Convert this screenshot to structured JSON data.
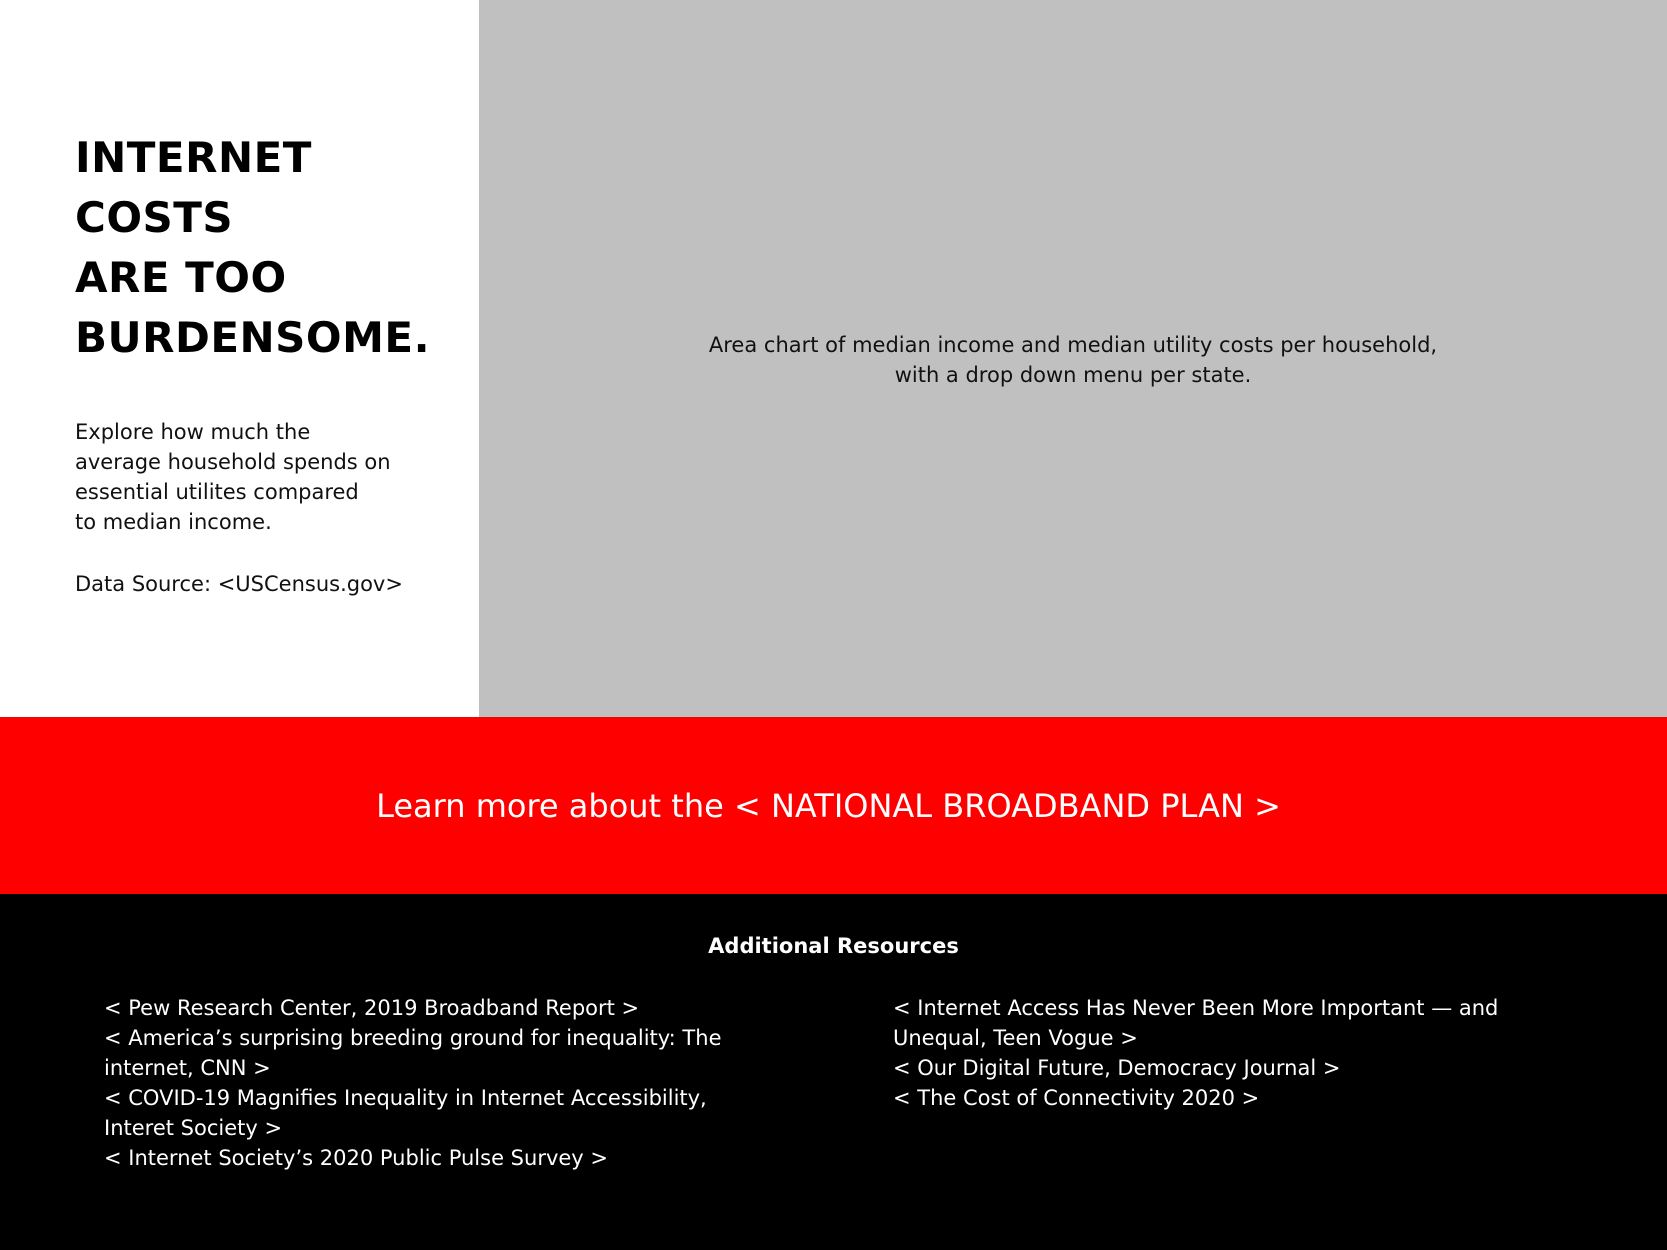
{
  "hero": {
    "headline_lines": [
      "INTERNET",
      "COSTS",
      "ARE TOO",
      "BURDENSOME."
    ],
    "intro_lines": [
      "Explore how much the",
      "average household spends on",
      "essential utilites compared",
      "to median income."
    ],
    "data_source": "Data Source: <USCensus.gov>"
  },
  "chart_panel": {
    "placeholder_lines": [
      "Area chart of median income and median utility costs per household,",
      "with a drop down menu per state."
    ],
    "background_color": "#c0c0c0"
  },
  "banner": {
    "prefix": "Learn more about the ",
    "link_label": "< NATIONAL BROADBAND PLAN >",
    "background_color": "#fe0000"
  },
  "resources": {
    "title": "Additional Resources",
    "left": [
      {
        "lines": [
          "< Pew Research Center, 2019 Broadband Report >"
        ]
      },
      {
        "lines": [
          "< America’s surprising breeding ground for inequality: The",
          "internet, CNN >"
        ]
      },
      {
        "lines": [
          "< COVID-19 Magnifies Inequality in Internet Accessibility,",
          "Interet Society >"
        ]
      },
      {
        "lines": [
          "< Internet Society’s 2020 Public Pulse Survey >"
        ]
      }
    ],
    "right": [
      {
        "lines": [
          "< Internet Access Has Never Been More Important — and",
          "Unequal, Teen Vogue >"
        ]
      },
      {
        "lines": [
          "< Our Digital Future, Democracy Journal >"
        ]
      },
      {
        "lines": [
          "< The Cost of Connectivity 2020 >"
        ]
      }
    ],
    "background_color": "#000000"
  }
}
